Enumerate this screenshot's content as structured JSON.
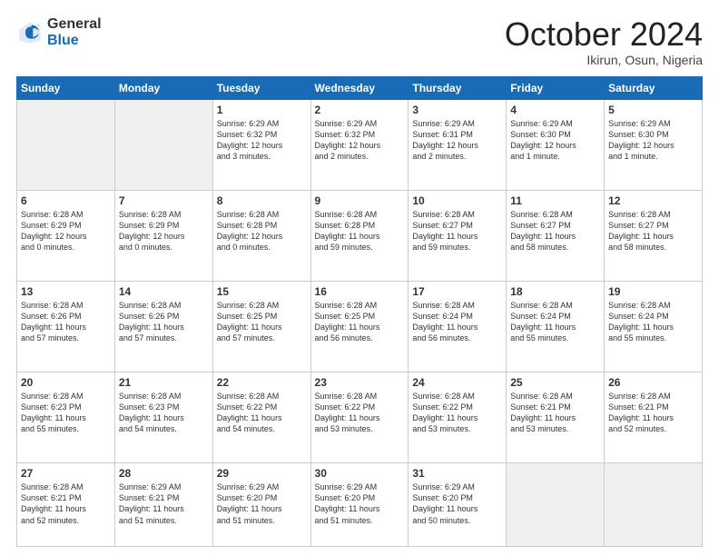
{
  "header": {
    "logo_general": "General",
    "logo_blue": "Blue",
    "month_title": "October 2024",
    "location": "Ikirun, Osun, Nigeria"
  },
  "weekdays": [
    "Sunday",
    "Monday",
    "Tuesday",
    "Wednesday",
    "Thursday",
    "Friday",
    "Saturday"
  ],
  "weeks": [
    [
      {
        "day": "",
        "info": ""
      },
      {
        "day": "",
        "info": ""
      },
      {
        "day": "1",
        "info": "Sunrise: 6:29 AM\nSunset: 6:32 PM\nDaylight: 12 hours\nand 3 minutes."
      },
      {
        "day": "2",
        "info": "Sunrise: 6:29 AM\nSunset: 6:32 PM\nDaylight: 12 hours\nand 2 minutes."
      },
      {
        "day": "3",
        "info": "Sunrise: 6:29 AM\nSunset: 6:31 PM\nDaylight: 12 hours\nand 2 minutes."
      },
      {
        "day": "4",
        "info": "Sunrise: 6:29 AM\nSunset: 6:30 PM\nDaylight: 12 hours\nand 1 minute."
      },
      {
        "day": "5",
        "info": "Sunrise: 6:29 AM\nSunset: 6:30 PM\nDaylight: 12 hours\nand 1 minute."
      }
    ],
    [
      {
        "day": "6",
        "info": "Sunrise: 6:28 AM\nSunset: 6:29 PM\nDaylight: 12 hours\nand 0 minutes."
      },
      {
        "day": "7",
        "info": "Sunrise: 6:28 AM\nSunset: 6:29 PM\nDaylight: 12 hours\nand 0 minutes."
      },
      {
        "day": "8",
        "info": "Sunrise: 6:28 AM\nSunset: 6:28 PM\nDaylight: 12 hours\nand 0 minutes."
      },
      {
        "day": "9",
        "info": "Sunrise: 6:28 AM\nSunset: 6:28 PM\nDaylight: 11 hours\nand 59 minutes."
      },
      {
        "day": "10",
        "info": "Sunrise: 6:28 AM\nSunset: 6:27 PM\nDaylight: 11 hours\nand 59 minutes."
      },
      {
        "day": "11",
        "info": "Sunrise: 6:28 AM\nSunset: 6:27 PM\nDaylight: 11 hours\nand 58 minutes."
      },
      {
        "day": "12",
        "info": "Sunrise: 6:28 AM\nSunset: 6:27 PM\nDaylight: 11 hours\nand 58 minutes."
      }
    ],
    [
      {
        "day": "13",
        "info": "Sunrise: 6:28 AM\nSunset: 6:26 PM\nDaylight: 11 hours\nand 57 minutes."
      },
      {
        "day": "14",
        "info": "Sunrise: 6:28 AM\nSunset: 6:26 PM\nDaylight: 11 hours\nand 57 minutes."
      },
      {
        "day": "15",
        "info": "Sunrise: 6:28 AM\nSunset: 6:25 PM\nDaylight: 11 hours\nand 57 minutes."
      },
      {
        "day": "16",
        "info": "Sunrise: 6:28 AM\nSunset: 6:25 PM\nDaylight: 11 hours\nand 56 minutes."
      },
      {
        "day": "17",
        "info": "Sunrise: 6:28 AM\nSunset: 6:24 PM\nDaylight: 11 hours\nand 56 minutes."
      },
      {
        "day": "18",
        "info": "Sunrise: 6:28 AM\nSunset: 6:24 PM\nDaylight: 11 hours\nand 55 minutes."
      },
      {
        "day": "19",
        "info": "Sunrise: 6:28 AM\nSunset: 6:24 PM\nDaylight: 11 hours\nand 55 minutes."
      }
    ],
    [
      {
        "day": "20",
        "info": "Sunrise: 6:28 AM\nSunset: 6:23 PM\nDaylight: 11 hours\nand 55 minutes."
      },
      {
        "day": "21",
        "info": "Sunrise: 6:28 AM\nSunset: 6:23 PM\nDaylight: 11 hours\nand 54 minutes."
      },
      {
        "day": "22",
        "info": "Sunrise: 6:28 AM\nSunset: 6:22 PM\nDaylight: 11 hours\nand 54 minutes."
      },
      {
        "day": "23",
        "info": "Sunrise: 6:28 AM\nSunset: 6:22 PM\nDaylight: 11 hours\nand 53 minutes."
      },
      {
        "day": "24",
        "info": "Sunrise: 6:28 AM\nSunset: 6:22 PM\nDaylight: 11 hours\nand 53 minutes."
      },
      {
        "day": "25",
        "info": "Sunrise: 6:28 AM\nSunset: 6:21 PM\nDaylight: 11 hours\nand 53 minutes."
      },
      {
        "day": "26",
        "info": "Sunrise: 6:28 AM\nSunset: 6:21 PM\nDaylight: 11 hours\nand 52 minutes."
      }
    ],
    [
      {
        "day": "27",
        "info": "Sunrise: 6:28 AM\nSunset: 6:21 PM\nDaylight: 11 hours\nand 52 minutes."
      },
      {
        "day": "28",
        "info": "Sunrise: 6:29 AM\nSunset: 6:21 PM\nDaylight: 11 hours\nand 51 minutes."
      },
      {
        "day": "29",
        "info": "Sunrise: 6:29 AM\nSunset: 6:20 PM\nDaylight: 11 hours\nand 51 minutes."
      },
      {
        "day": "30",
        "info": "Sunrise: 6:29 AM\nSunset: 6:20 PM\nDaylight: 11 hours\nand 51 minutes."
      },
      {
        "day": "31",
        "info": "Sunrise: 6:29 AM\nSunset: 6:20 PM\nDaylight: 11 hours\nand 50 minutes."
      },
      {
        "day": "",
        "info": ""
      },
      {
        "day": "",
        "info": ""
      }
    ]
  ]
}
